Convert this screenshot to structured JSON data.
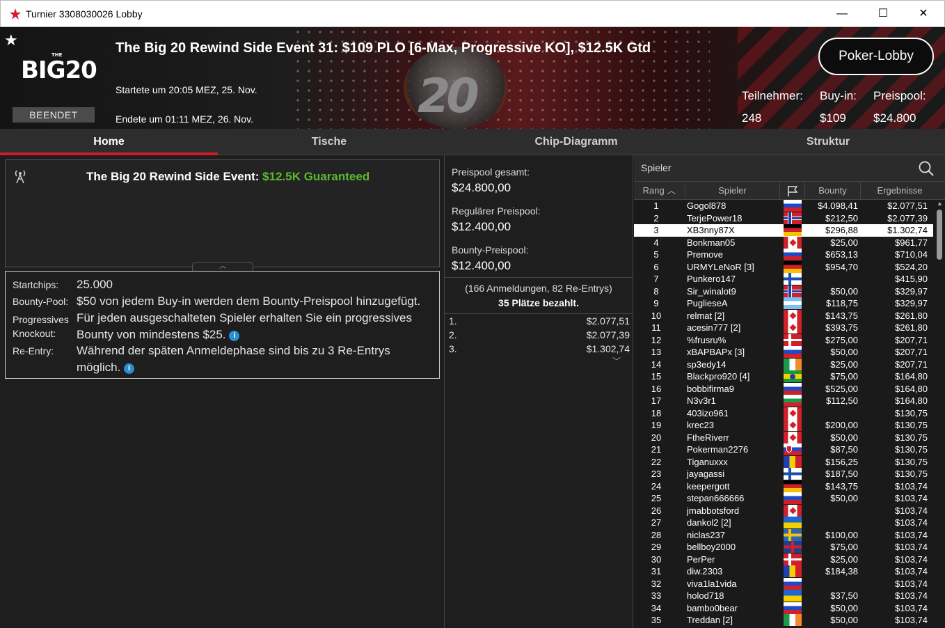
{
  "window": {
    "title": "Turnier 3308030026 Lobby",
    "minimize": "—",
    "maximize": "☐",
    "close": "✕"
  },
  "header": {
    "title": "The Big 20 Rewind Side Event 31: $109 PLO [6-Max, Progressive KO], $12.5K Gtd",
    "started": "Startete um 20:05 MEZ, 25. Nov.",
    "ended": "Endete um 01:11 MEZ, 26. Nov.",
    "status": "BEENDET",
    "logo_text": "BIG20",
    "logo_small": "THE",
    "lobby_button": "Poker-Lobby",
    "stats": {
      "players_label": "Teilnehmer:",
      "players_value": "248",
      "buyin_label": "Buy-in:",
      "buyin_value": "$109",
      "prizepool_label": "Preispool:",
      "prizepool_value": "$24.800"
    }
  },
  "tabs": [
    "Home",
    "Tische",
    "Chip-Diagramm",
    "Struktur"
  ],
  "info": {
    "title": "The Big 20 Rewind Side Event: ",
    "title_highlight": "$12.5K Guaranteed",
    "details": [
      {
        "label": "Startchips:",
        "value": "25.000"
      },
      {
        "label": "Bounty-Pool:",
        "value": "$50 von jedem Buy-in werden dem Bounty-Preispool hinzugefügt."
      },
      {
        "label": "Progressives Knockout:",
        "value": "Für jeden ausgeschalteten Spieler erhalten Sie ein progressives Bounty von mindestens $25."
      },
      {
        "label": "Re-Entry:",
        "value": "Während der späten Anmeldephase sind bis zu 3 Re-Entrys möglich."
      }
    ]
  },
  "prize": {
    "total_label": "Preispool gesamt:",
    "total": "$24.800,00",
    "regular_label": "Regulärer Preispool:",
    "regular": "$12.400,00",
    "bounty_label": "Bounty-Preispool:",
    "bounty": "$12.400,00",
    "registrations": "(166 Anmeldungen, 82 Re-Entrys)",
    "paid": "35 Plätze bezahlt.",
    "places": [
      {
        "place": "1.",
        "amount": "$2.077,51"
      },
      {
        "place": "2.",
        "amount": "$2.077,39"
      },
      {
        "place": "3.",
        "amount": "$1.302,74"
      }
    ]
  },
  "players": {
    "search_placeholder": "Spieler",
    "columns": {
      "rank": "Rang",
      "player": "Spieler",
      "bounty": "Bounty",
      "result": "Ergebnisse"
    },
    "rows": [
      {
        "rank": "1",
        "name": "Gogol878",
        "bounty": "$4.098,41",
        "result": "$2.077,51",
        "flag": "ru"
      },
      {
        "rank": "2",
        "name": "TerjePower18",
        "bounty": "$212,50",
        "result": "$2.077,39",
        "flag": "no"
      },
      {
        "rank": "3",
        "name": "XB3nny87X",
        "bounty": "$296,88",
        "result": "$1.302,74",
        "flag": "de"
      },
      {
        "rank": "4",
        "name": "Bonkman05",
        "bounty": "$25,00",
        "result": "$961,77",
        "flag": "ca"
      },
      {
        "rank": "5",
        "name": "Premove",
        "bounty": "$653,13",
        "result": "$710,04",
        "flag": "ru"
      },
      {
        "rank": "6",
        "name": "URMYLeNoR [3]",
        "bounty": "$954,70",
        "result": "$524,20",
        "flag": "de"
      },
      {
        "rank": "7",
        "name": "Punkero147",
        "bounty": "",
        "result": "$415,90",
        "flag": "fi"
      },
      {
        "rank": "8",
        "name": "Sir_winalot9",
        "bounty": "$50,00",
        "result": "$329,97",
        "flag": "no"
      },
      {
        "rank": "9",
        "name": "PuglieseA",
        "bounty": "$118,75",
        "result": "$329,97",
        "flag": "ar"
      },
      {
        "rank": "10",
        "name": "relmat [2]",
        "bounty": "$143,75",
        "result": "$261,80",
        "flag": "ca"
      },
      {
        "rank": "11",
        "name": "acesin777 [2]",
        "bounty": "$393,75",
        "result": "$261,80",
        "flag": "ca"
      },
      {
        "rank": "12",
        "name": "%frusru%",
        "bounty": "$275,00",
        "result": "$207,71",
        "flag": "dk"
      },
      {
        "rank": "13",
        "name": "xBAPBAPx [3]",
        "bounty": "$50,00",
        "result": "$207,71",
        "flag": "ru"
      },
      {
        "rank": "14",
        "name": "sp3edy14",
        "bounty": "$25,00",
        "result": "$207,71",
        "flag": "ie"
      },
      {
        "rank": "15",
        "name": "Blackpro920 [4]",
        "bounty": "$75,00",
        "result": "$164,80",
        "flag": "br"
      },
      {
        "rank": "16",
        "name": "bobbifirma9",
        "bounty": "$525,00",
        "result": "$164,80",
        "flag": "ru"
      },
      {
        "rank": "17",
        "name": "N3v3r1",
        "bounty": "$112,50",
        "result": "$164,80",
        "flag": "bg"
      },
      {
        "rank": "18",
        "name": "403izo961",
        "bounty": "",
        "result": "$130,75",
        "flag": "ca"
      },
      {
        "rank": "19",
        "name": "krec23",
        "bounty": "$200,00",
        "result": "$130,75",
        "flag": "ca"
      },
      {
        "rank": "20",
        "name": "FtheRiverr",
        "bounty": "$50,00",
        "result": "$130,75",
        "flag": "ca"
      },
      {
        "rank": "21",
        "name": "Pokerman2276",
        "bounty": "$87,50",
        "result": "$130,75",
        "flag": "sk"
      },
      {
        "rank": "22",
        "name": "Tiganuxxx",
        "bounty": "$156,25",
        "result": "$130,75",
        "flag": "ro"
      },
      {
        "rank": "23",
        "name": "jayagassi",
        "bounty": "$187,50",
        "result": "$130,75",
        "flag": "fi"
      },
      {
        "rank": "24",
        "name": "keepergott",
        "bounty": "$143,75",
        "result": "$103,74",
        "flag": "de"
      },
      {
        "rank": "25",
        "name": "stepan666666",
        "bounty": "$50,00",
        "result": "$103,74",
        "flag": "ru"
      },
      {
        "rank": "26",
        "name": "jmabbotsford",
        "bounty": "",
        "result": "$103,74",
        "flag": "ca"
      },
      {
        "rank": "27",
        "name": "dankol2 [2]",
        "bounty": "",
        "result": "$103,74",
        "flag": "ua"
      },
      {
        "rank": "28",
        "name": "niclas237",
        "bounty": "$100,00",
        "result": "$103,74",
        "flag": "se"
      },
      {
        "rank": "29",
        "name": "bellboy2000",
        "bounty": "$75,00",
        "result": "$103,74",
        "flag": "gb"
      },
      {
        "rank": "30",
        "name": "PerPer",
        "bounty": "$25,00",
        "result": "$103,74",
        "flag": "dk"
      },
      {
        "rank": "31",
        "name": "diw.2303",
        "bounty": "$184,38",
        "result": "$103,74",
        "flag": "ro"
      },
      {
        "rank": "32",
        "name": "viva1la1vida",
        "bounty": "",
        "result": "$103,74",
        "flag": "ru"
      },
      {
        "rank": "33",
        "name": "holod718",
        "bounty": "$37,50",
        "result": "$103,74",
        "flag": "ua"
      },
      {
        "rank": "34",
        "name": "bambo0bear",
        "bounty": "$50,00",
        "result": "$103,74",
        "flag": "ru"
      },
      {
        "rank": "35",
        "name": "Treddan [2]",
        "bounty": "$50,00",
        "result": "$103,74",
        "flag": "ie"
      }
    ]
  }
}
